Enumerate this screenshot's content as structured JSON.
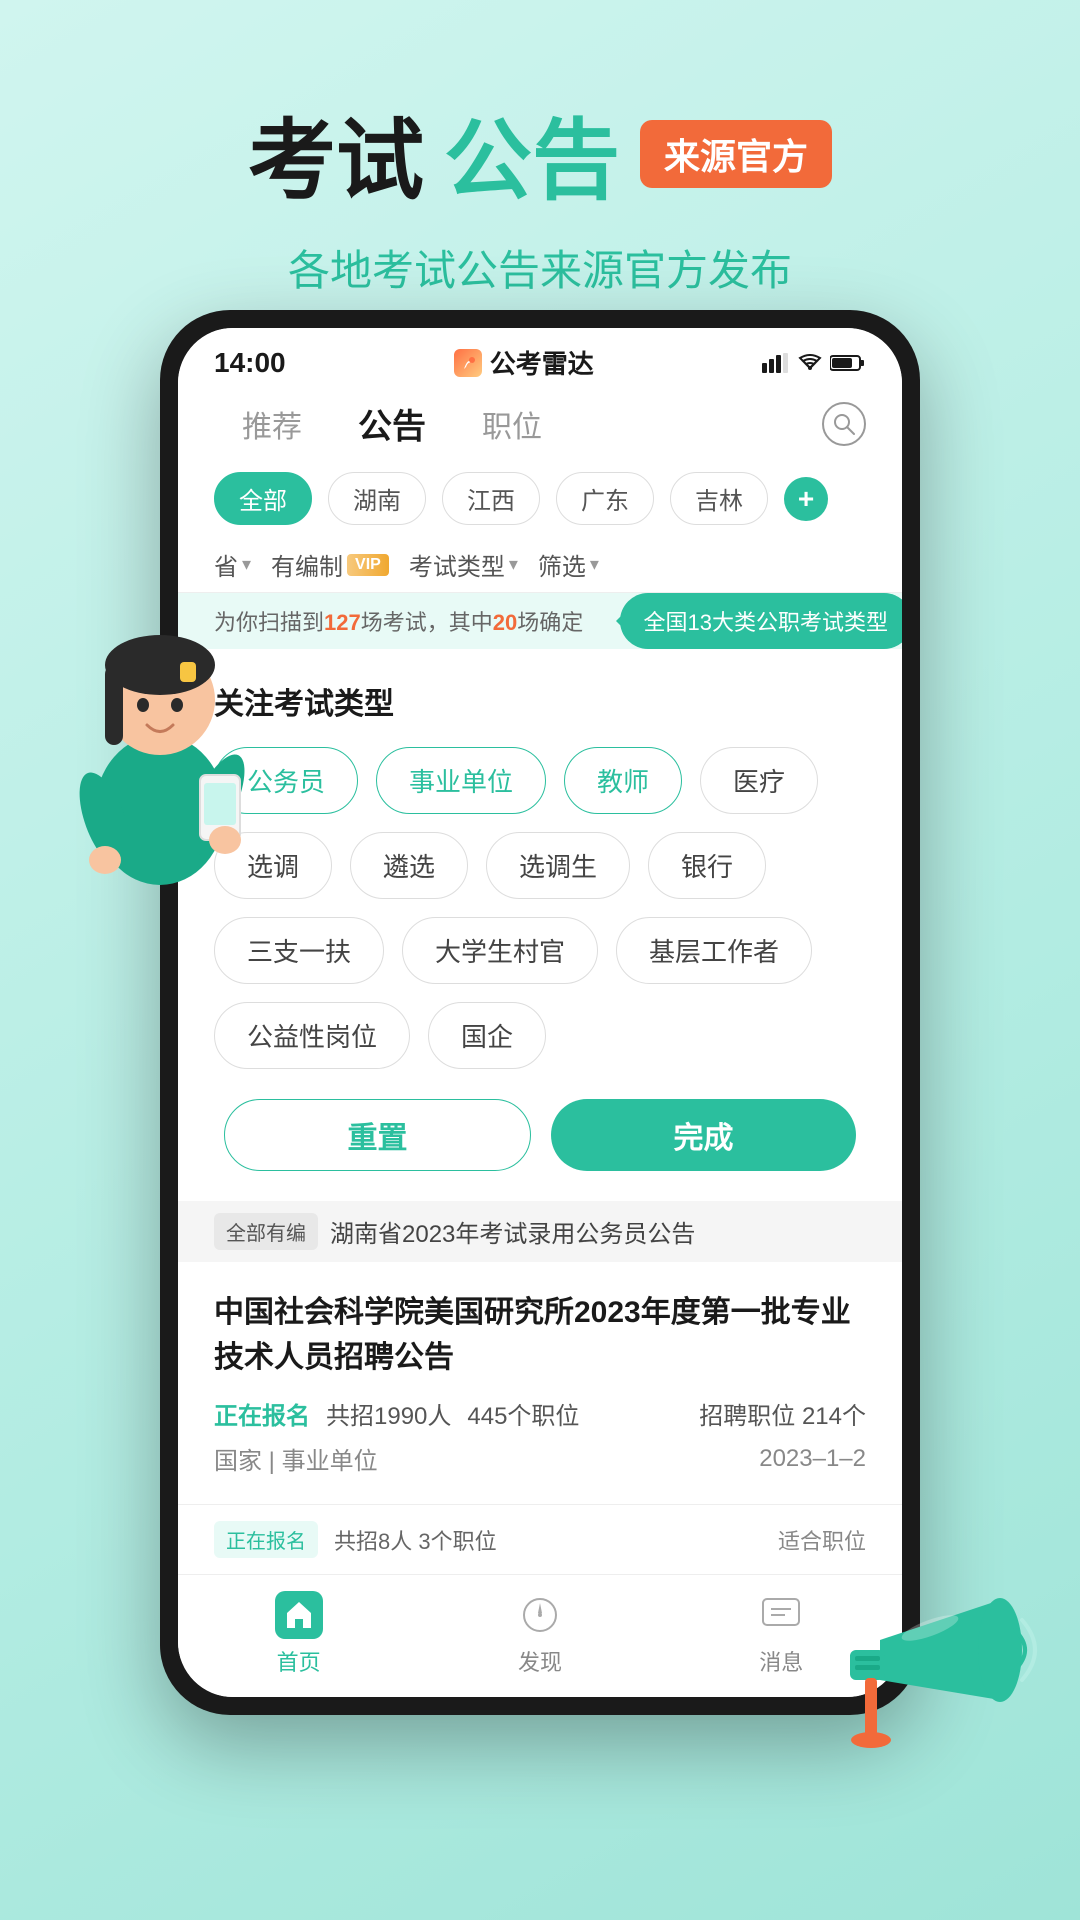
{
  "header": {
    "title_black": "考试",
    "title_green": "公告",
    "badge": "来源官方",
    "subtitle": "各地考试公告来源官方发布"
  },
  "phone": {
    "status_bar": {
      "time": "14:00",
      "app_name": "公考雷达",
      "signal": "▪▪▪",
      "wifi": "WiFi",
      "battery": "▊"
    },
    "nav_tabs": [
      {
        "label": "推荐",
        "active": false
      },
      {
        "label": "公告",
        "active": true
      },
      {
        "label": "职位",
        "active": false
      }
    ],
    "region_tabs": [
      {
        "label": "全部",
        "selected": false
      },
      {
        "label": "湖南",
        "selected": false
      },
      {
        "label": "江西",
        "selected": false
      },
      {
        "label": "广东",
        "selected": false
      },
      {
        "label": "吉林",
        "selected": false
      }
    ],
    "filter_row": {
      "items": [
        "省▾",
        "有编制VIP",
        "考试类型▾",
        "筛选▾"
      ]
    },
    "scan_info": "为你扫描到127场考试，其中20场确定",
    "tooltip": "全国13大类公职考试类型",
    "exam_panel": {
      "title": "关注考试类型",
      "tags": [
        {
          "label": "公务员",
          "active": true
        },
        {
          "label": "事业单位",
          "active": true
        },
        {
          "label": "教师",
          "active": true
        },
        {
          "label": "医疗",
          "active": false
        },
        {
          "label": "选调",
          "active": false
        },
        {
          "label": "遴选",
          "active": false
        },
        {
          "label": "选调生",
          "active": false
        },
        {
          "label": "银行",
          "active": false
        },
        {
          "label": "三支一扶",
          "active": false
        },
        {
          "label": "大学生村官",
          "active": false
        },
        {
          "label": "基层工作者",
          "active": false
        },
        {
          "label": "公益性岗位",
          "active": false
        },
        {
          "label": "国企",
          "active": false
        }
      ],
      "btn_reset": "重置",
      "btn_done": "完成"
    },
    "announcement_bar": {
      "badge": "全部有编",
      "text": "湖南省2023年考试录用公务员公告"
    },
    "news_card": {
      "title": "中国社会科学院美国研究所2023年度第一批专业技术人员招聘公告",
      "status": "正在报名",
      "recruit_count": "共招1990人",
      "positions": "445个职位",
      "right_text": "招聘职位 214个",
      "category": "国家 | 事业单位",
      "date": "2023–1–2"
    },
    "news_card2": {
      "status": "正在报名",
      "meta": "共招8人 3个职位",
      "right": "适合职位"
    },
    "bottom_nav": [
      {
        "label": "首页",
        "active": true,
        "icon": "🏠"
      },
      {
        "label": "发现",
        "active": false,
        "icon": "🧭"
      },
      {
        "label": "消息",
        "active": false,
        "icon": "💬"
      }
    ]
  }
}
